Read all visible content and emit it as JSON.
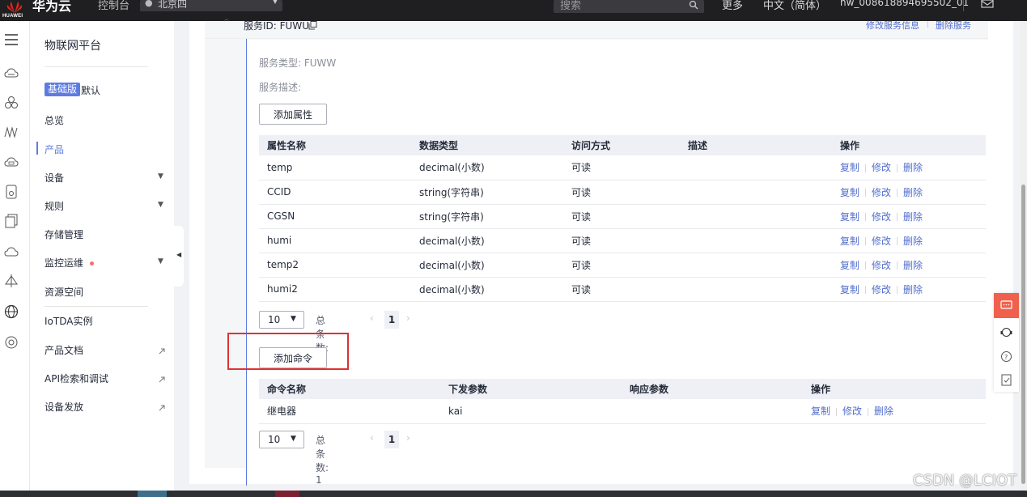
{
  "topbar": {
    "logo_text": "HUAWEI",
    "brand": "华为云",
    "console": "控制台",
    "region": "北京四",
    "search_placeholder": "搜索",
    "more": "更多",
    "language": "中文（简体）",
    "user": "hw_008618894695502_01"
  },
  "sidebar": {
    "title": "物联网平台",
    "edition_badge": "基础版",
    "edition_default": "默认",
    "items": [
      {
        "label": "总览"
      },
      {
        "label": "产品"
      },
      {
        "label": "设备"
      },
      {
        "label": "规则"
      },
      {
        "label": "存储管理"
      },
      {
        "label": "监控运维"
      },
      {
        "label": "资源空间"
      },
      {
        "label": "IoTDA实例"
      },
      {
        "label": "产品文档"
      },
      {
        "label": "API检索和调试"
      },
      {
        "label": "设备发放"
      }
    ]
  },
  "service": {
    "id_label": "服务ID: FUWU",
    "edit_link": "修改服务信息",
    "delete_link": "删除服务",
    "type_label": "服务类型: FUWW",
    "desc_label": "服务描述:",
    "add_property_btn": "添加属性",
    "add_command_btn": "添加命令"
  },
  "properties": {
    "headers": [
      "属性名称",
      "数据类型",
      "访问方式",
      "描述",
      "操作"
    ],
    "rows": [
      {
        "name": "temp",
        "type": "decimal(小数)",
        "access": "可读",
        "desc": ""
      },
      {
        "name": "CCID",
        "type": "string(字符串)",
        "access": "可读",
        "desc": ""
      },
      {
        "name": "CGSN",
        "type": "string(字符串)",
        "access": "可读",
        "desc": ""
      },
      {
        "name": "humi",
        "type": "decimal(小数)",
        "access": "可读",
        "desc": ""
      },
      {
        "name": "temp2",
        "type": "decimal(小数)",
        "access": "可读",
        "desc": ""
      },
      {
        "name": "humi2",
        "type": "decimal(小数)",
        "access": "可读",
        "desc": ""
      }
    ],
    "ops": {
      "copy": "复制",
      "edit": "修改",
      "delete": "删除"
    },
    "pager": {
      "page_size": "10",
      "total": "总条数: 6",
      "page": "1"
    }
  },
  "commands": {
    "headers": [
      "命令名称",
      "下发参数",
      "响应参数",
      "操作"
    ],
    "rows": [
      {
        "name": "继电器",
        "params": "kai",
        "response": ""
      }
    ],
    "ops": {
      "copy": "复制",
      "edit": "修改",
      "delete": "删除"
    },
    "pager": {
      "page_size": "10",
      "total": "总条数: 1",
      "page": "1"
    }
  },
  "watermark": "CSDN @LCIOT",
  "colors": {
    "accent": "#5e7ce0",
    "link": "#526ecc",
    "highlight": "#e03131",
    "chat": "#f0614d"
  }
}
